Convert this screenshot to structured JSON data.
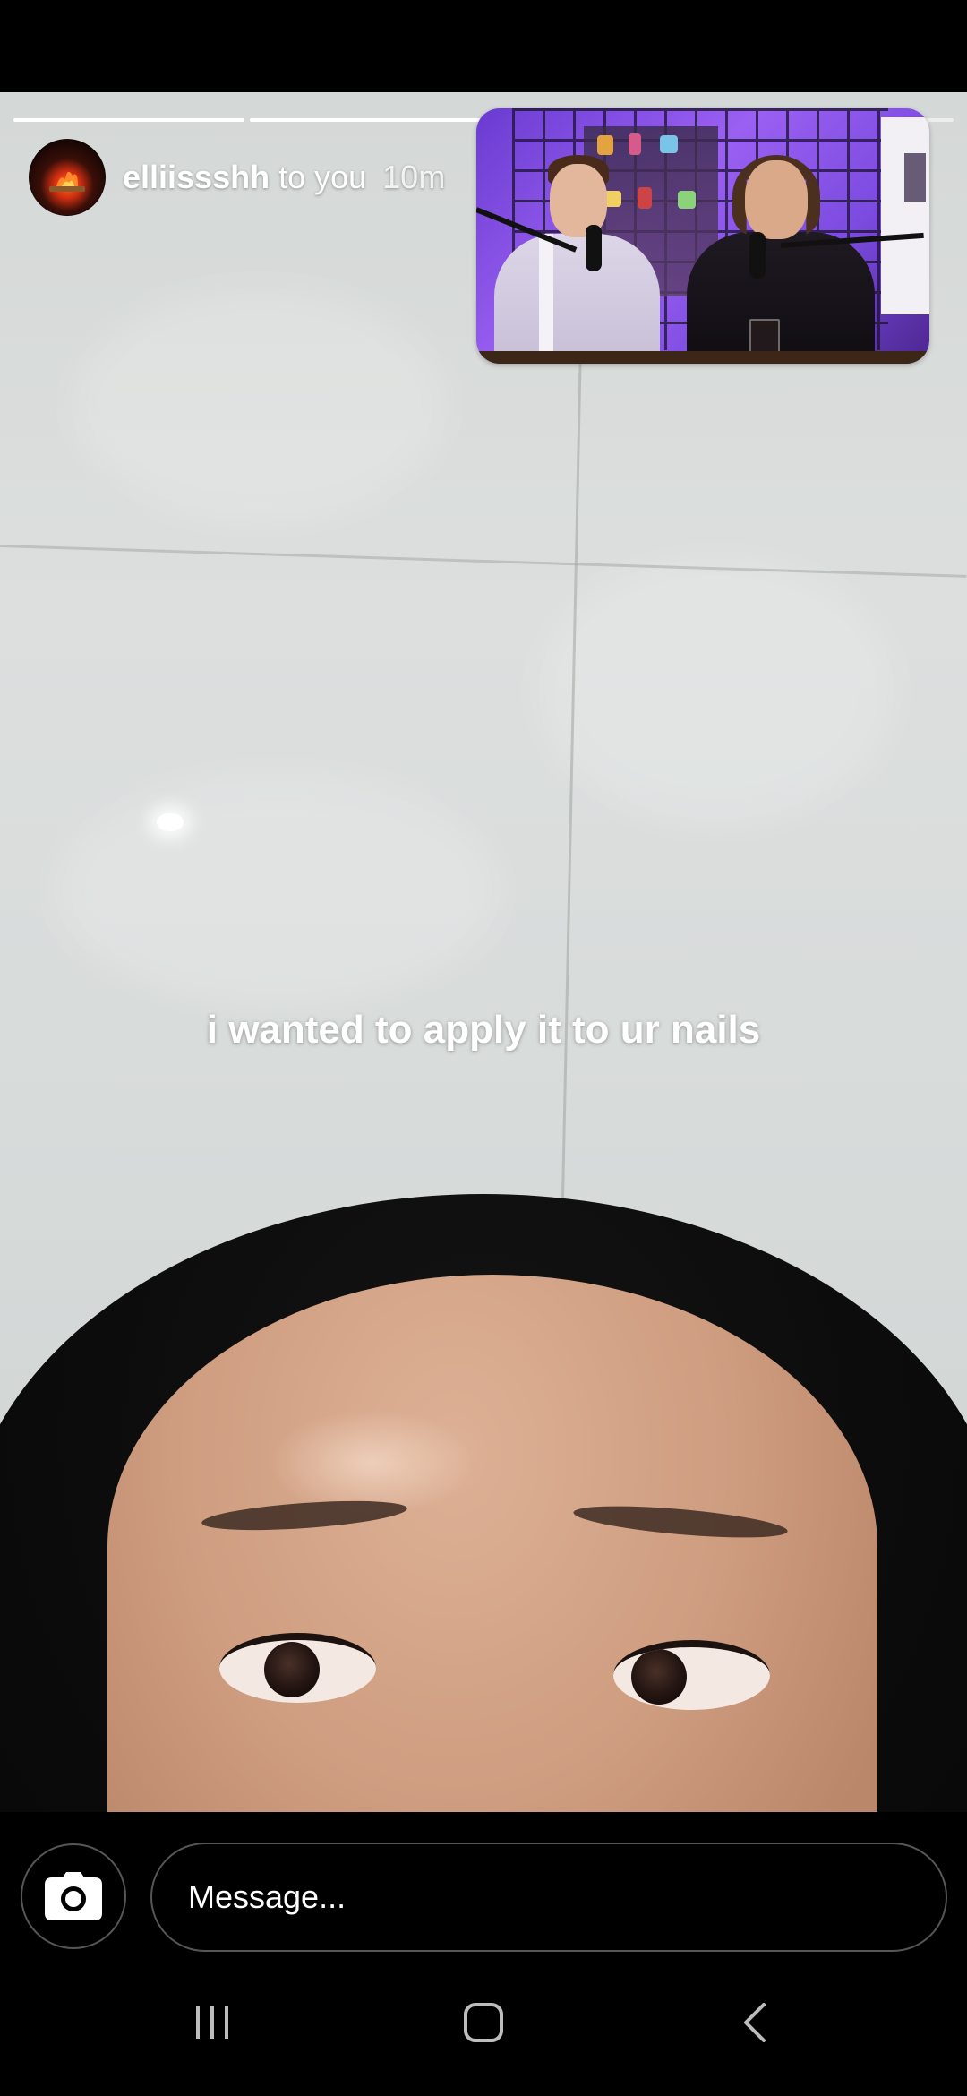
{
  "story": {
    "username": "elliissshh",
    "audience": "to you",
    "timestamp": "10m",
    "progress_segments": [
      {
        "state": "done"
      },
      {
        "state": "done"
      },
      {
        "state": "current"
      },
      {
        "state": "pending"
      }
    ],
    "caption": "i wanted to apply it to ur nails"
  },
  "reply_bar": {
    "camera_icon": "camera-icon",
    "message_placeholder": "Message..."
  },
  "system_nav": {
    "recents_icon": "recents-icon",
    "home_icon": "home-icon",
    "back_icon": "back-icon"
  },
  "colors": {
    "background": "#000000",
    "text": "#ffffff",
    "outline": "#565656",
    "sticker_accent": "#9a60f2"
  }
}
